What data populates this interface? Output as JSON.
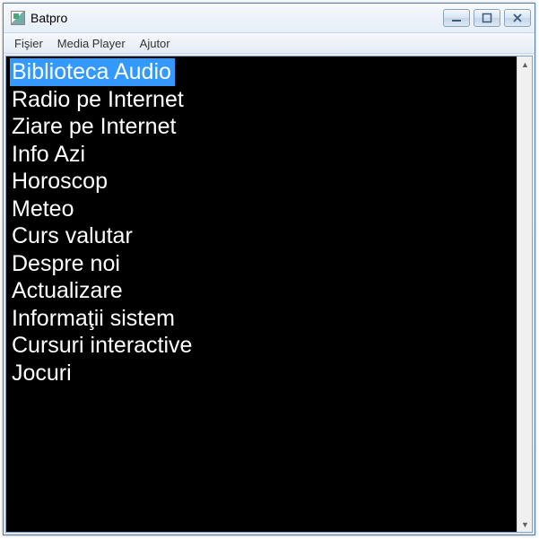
{
  "window": {
    "title": "Batpro"
  },
  "menubar": {
    "items": [
      {
        "label": "Fişier"
      },
      {
        "label": "Media Player"
      },
      {
        "label": "Ajutor"
      }
    ]
  },
  "listbox": {
    "selected_index": 0,
    "items": [
      {
        "label": "Biblioteca Audio"
      },
      {
        "label": "Radio pe Internet"
      },
      {
        "label": "Ziare pe Internet"
      },
      {
        "label": "Info Azi"
      },
      {
        "label": "Horoscop"
      },
      {
        "label": "Meteo"
      },
      {
        "label": "Curs valutar"
      },
      {
        "label": "Despre noi"
      },
      {
        "label": "Actualizare"
      },
      {
        "label": "Informaţii sistem"
      },
      {
        "label": "Cursuri interactive"
      },
      {
        "label": "Jocuri"
      }
    ]
  }
}
